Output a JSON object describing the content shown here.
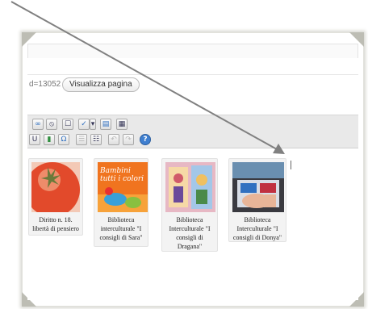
{
  "permalink": {
    "text": "d=13052",
    "button_label": "Visualizza pagina"
  },
  "toolbar": {
    "row1_icons": [
      "link-icon",
      "unlink-icon",
      "more-tag-icon",
      "spellcheck-icon",
      "spellcheck-dropdown-icon",
      "fullscreen-icon",
      "kitchen-sink-icon"
    ],
    "row2_icons": [
      "underline-icon",
      "justify-icon",
      "text-color-icon",
      "paste-text-icon",
      "paste-word-icon",
      "remove-format-icon",
      "special-char-icon",
      "outdent-icon",
      "indent-icon",
      "undo-icon",
      "redo-icon",
      "help-icon"
    ]
  },
  "gallery": {
    "items": [
      {
        "caption": "Diritto n. 18.\nlibertà di pensiero",
        "thumb_text": ""
      },
      {
        "caption": "Biblioteca\ninterculturale \"I\nconsigli di Sara\"",
        "thumb_text": "Bambini\ntutti i colori"
      },
      {
        "caption": "Biblioteca\nInterculturale \"I\nconsigli di\nDragana\"",
        "thumb_text": ""
      },
      {
        "caption": "Biblioteca\nInterculturale \"I\nconsigli di Donya\"",
        "thumb_text": ""
      }
    ]
  },
  "colors": {
    "arrow": "#808080",
    "toolbar_bg": "#e9e9e9",
    "card_bg": "#f3f3f3"
  }
}
